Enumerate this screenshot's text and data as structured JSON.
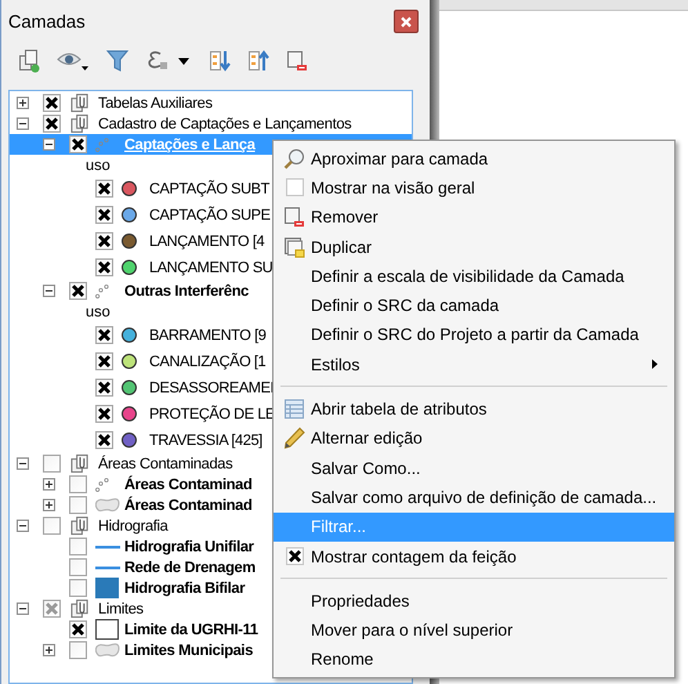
{
  "window": {
    "title": "Camadas"
  },
  "tree": [
    {
      "label": "Tabelas Auxiliares",
      "kind": "group",
      "checked": true,
      "expanded": false,
      "selected": false
    },
    {
      "label": "Cadastro de Captações e Lançamentos",
      "kind": "group",
      "checked": true,
      "expanded": true,
      "selected": false,
      "children": [
        {
          "label": "Captações e Lança",
          "kind": "points",
          "checked": true,
          "expanded": true,
          "selected": true,
          "legend_heading": "uso",
          "classes": [
            {
              "label": "CAPTAÇÃO SUBT",
              "checked": true,
              "color": "#d9575f"
            },
            {
              "label": "CAPTAÇÃO SUPE",
              "checked": true,
              "color": "#6aa8e8"
            },
            {
              "label": "LANÇAMENTO [4",
              "checked": true,
              "color": "#7a5a30"
            },
            {
              "label": "LANÇAMENTO SU",
              "checked": true,
              "color": "#4fd36d"
            }
          ]
        },
        {
          "label": "Outras Interferênc",
          "kind": "points",
          "checked": true,
          "expanded": true,
          "selected": false,
          "legend_heading": "uso",
          "classes": [
            {
              "label": "BARRAMENTO [9",
              "checked": true,
              "color": "#45b1dc"
            },
            {
              "label": "CANALIZAÇÃO [1",
              "checked": true,
              "color": "#bde37a"
            },
            {
              "label": "DESASSOREAMEI",
              "checked": true,
              "color": "#52c473"
            },
            {
              "label": "PROTEÇÃO DE LE",
              "checked": true,
              "color": "#e8448b"
            },
            {
              "label": "TRAVESSIA [425]",
              "checked": true,
              "color": "#7060c4"
            }
          ]
        }
      ]
    },
    {
      "label": "Áreas Contaminadas",
      "kind": "group",
      "checked": false,
      "expanded": true,
      "selected": false,
      "children": [
        {
          "label": "Áreas Contaminad",
          "kind": "points",
          "checked": false,
          "expanded": false,
          "selected": false
        },
        {
          "label": "Áreas Contaminad",
          "kind": "polygon",
          "checked": false,
          "expanded": false,
          "selected": false
        }
      ]
    },
    {
      "label": "Hidrografia",
      "kind": "group",
      "checked": false,
      "expanded": true,
      "selected": false,
      "children": [
        {
          "label": "Hidrografia Unifilar",
          "kind": "line",
          "checked": false,
          "selected": false
        },
        {
          "label": "Rede de Drenagem",
          "kind": "line",
          "checked": false,
          "selected": false
        },
        {
          "label": "Hidrografia Bifilar",
          "kind": "fill",
          "color": "#2a7ab8",
          "checked": false,
          "selected": false
        }
      ]
    },
    {
      "label": "Limites",
      "kind": "group",
      "checked": true,
      "partial": true,
      "expanded": true,
      "selected": false,
      "children": [
        {
          "label": "Limite da UGRHI-11",
          "kind": "fill",
          "color": "#ffffff",
          "checked": true,
          "selected": false
        },
        {
          "label": "Limites Municipais",
          "kind": "polygon",
          "checked": false,
          "expanded": false,
          "selected": false
        }
      ]
    }
  ],
  "context_menu": {
    "sections": [
      [
        {
          "label": "Aproximar para camada",
          "kind": "action",
          "selected": false
        },
        {
          "label": "Mostrar na visão geral",
          "kind": "check",
          "checked": false,
          "selected": false
        },
        {
          "label": "Remover",
          "kind": "action",
          "selected": false
        },
        {
          "label": "Duplicar",
          "kind": "action",
          "selected": false
        },
        {
          "label": "Definir a escala de visibilidade da Camada",
          "kind": "action",
          "selected": false
        },
        {
          "label": "Definir o SRC da camada",
          "kind": "action",
          "selected": false
        },
        {
          "label": "Definir o SRC do Projeto a partir da Camada",
          "kind": "action",
          "selected": false
        },
        {
          "label": "Estilos",
          "kind": "submenu",
          "selected": false
        }
      ],
      [
        {
          "label": "Abrir tabela de atributos",
          "kind": "action",
          "selected": false
        },
        {
          "label": "Alternar edição",
          "kind": "action",
          "selected": false
        },
        {
          "label": "Salvar Como...",
          "kind": "action",
          "selected": false
        },
        {
          "label": "Salvar como arquivo de definição de camada...",
          "kind": "action",
          "selected": false
        },
        {
          "label": "Filtrar...",
          "kind": "action",
          "selected": true
        },
        {
          "label": "Mostrar contagem da feição",
          "kind": "check",
          "checked": true,
          "selected": false
        }
      ],
      [
        {
          "label": "Propriedades",
          "kind": "action",
          "selected": false
        },
        {
          "label": "Mover para o nível superior",
          "kind": "action",
          "selected": false
        },
        {
          "label": "Renome",
          "kind": "action",
          "selected": false
        }
      ]
    ]
  }
}
